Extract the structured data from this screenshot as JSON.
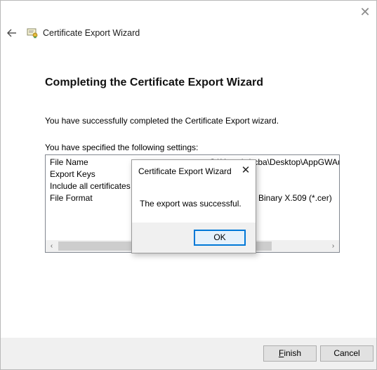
{
  "window": {
    "title": "Certificate Export Wizard",
    "close_icon": "close-icon",
    "back_icon": "back-arrow-icon",
    "app_icon": "certificate-icon"
  },
  "page": {
    "heading": "Completing the Certificate Export Wizard",
    "description": "You have successfully completed the Certificate Export wizard.",
    "settings_label": "You have specified the following settings:"
  },
  "settings": {
    "rows": [
      {
        "name": "File Name",
        "value": "C:\\Users\\abcba\\Desktop\\AppGWAuthe"
      },
      {
        "name": "Export Keys",
        "value": ""
      },
      {
        "name": "Include all certificates in",
        "value": ""
      },
      {
        "name": "File Format",
        "value": "Binary X.509 (*.cer)"
      }
    ],
    "scroll_left": "‹",
    "scroll_right": "›"
  },
  "footer": {
    "finish_label": "Finish",
    "finish_accel": "F",
    "cancel_label": "Cancel"
  },
  "dialog": {
    "title": "Certificate Export Wizard",
    "message": "The export was successful.",
    "ok_label": "OK",
    "close_glyph": "✕"
  },
  "colors": {
    "accent": "#0078d7",
    "footer_bg": "#f0f0f0",
    "button_bg": "#e1e1e1"
  }
}
